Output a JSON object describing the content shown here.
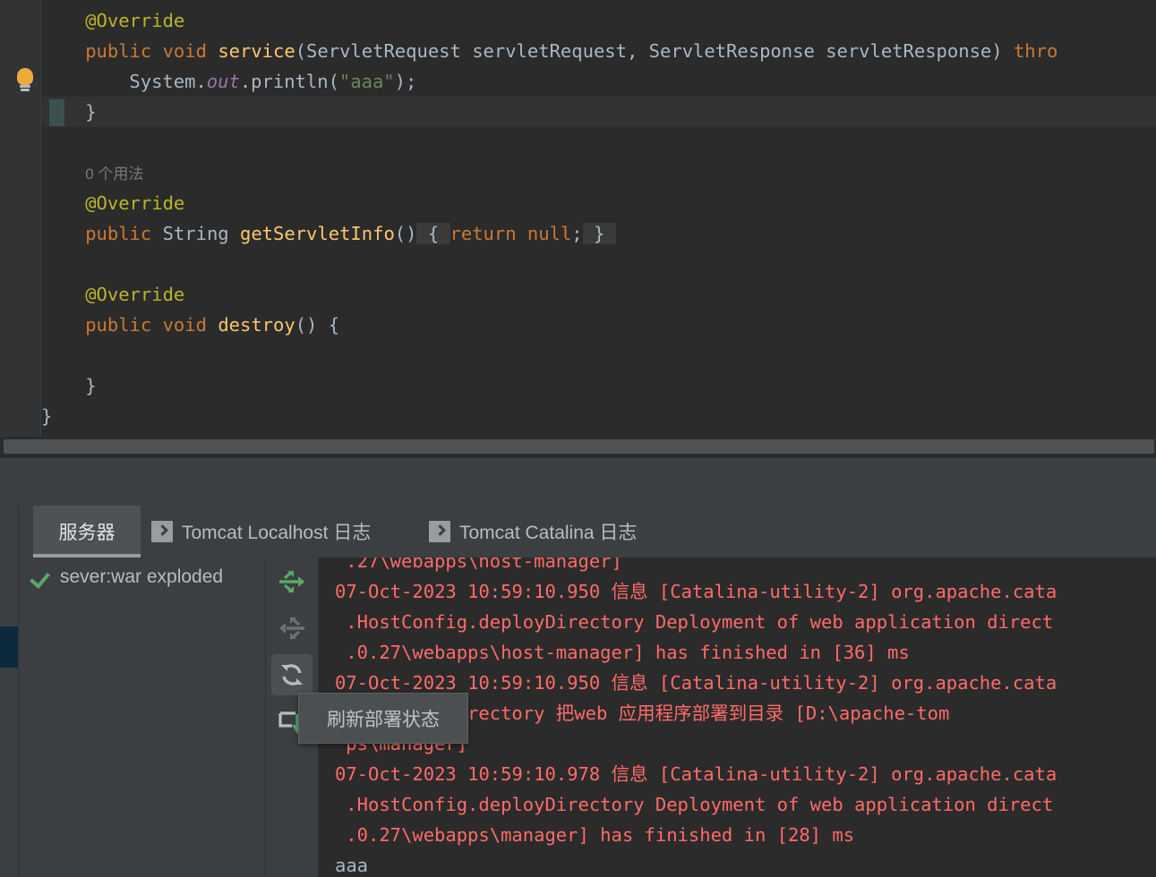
{
  "editor": {
    "name": "java-editor",
    "gutter_icon": "lightbulb-icon",
    "lines": [
      {
        "indent": 1,
        "segments": [
          {
            "t": "@Override",
            "c": "an"
          }
        ]
      },
      {
        "indent": 1,
        "segments": [
          {
            "t": "public ",
            "c": "kw"
          },
          {
            "t": "void ",
            "c": "kw"
          },
          {
            "t": "service",
            "c": "mth"
          },
          {
            "t": "(ServletRequest servletRequest, ServletResponse servletResponse) ",
            "c": "pln"
          },
          {
            "t": "thro",
            "c": "kw"
          }
        ]
      },
      {
        "indent": 2,
        "segments": [
          {
            "t": "System.",
            "c": "pln"
          },
          {
            "t": "out",
            "c": "fld"
          },
          {
            "t": ".println(",
            "c": "pln"
          },
          {
            "t": "\"aaa\"",
            "c": "str"
          },
          {
            "t": ");",
            "c": "pln"
          }
        ]
      },
      {
        "indent": 1,
        "segments": [
          {
            "t": "}",
            "c": "pln"
          }
        ]
      },
      {
        "indent": 0,
        "segments": []
      },
      {
        "indent": 1,
        "segments": [
          {
            "t": "0 个用法",
            "c": "inlay"
          }
        ]
      },
      {
        "indent": 1,
        "segments": [
          {
            "t": "@Override",
            "c": "an"
          }
        ]
      },
      {
        "indent": 1,
        "segments": [
          {
            "t": "public ",
            "c": "kw"
          },
          {
            "t": "String ",
            "c": "typ"
          },
          {
            "t": "getServletInfo",
            "c": "mth"
          },
          {
            "t": "()",
            "c": "pln"
          }
        ]
      },
      {
        "indent": 0,
        "segments": []
      },
      {
        "indent": 1,
        "segments": [
          {
            "t": "@Override",
            "c": "an"
          }
        ]
      },
      {
        "indent": 1,
        "segments": [
          {
            "t": "public ",
            "c": "kw"
          },
          {
            "t": "void ",
            "c": "kw"
          },
          {
            "t": "destroy",
            "c": "mth"
          },
          {
            "t": "() {",
            "c": "pln"
          }
        ]
      },
      {
        "indent": 0,
        "segments": []
      },
      {
        "indent": 1,
        "segments": [
          {
            "t": "}",
            "c": "pln"
          }
        ]
      },
      {
        "indent": 0,
        "segments": [
          {
            "t": "}",
            "c": "pln"
          }
        ]
      }
    ],
    "folded_body": {
      "open_brace": "{",
      "body": " return null; ",
      "close_brace": "}"
    },
    "inlay_hint": "0 个用法"
  },
  "tool_window": {
    "tabs": [
      {
        "id": "tab-services",
        "label": "服务器",
        "icon": null,
        "active": true
      },
      {
        "id": "tab-tomcat-localhost",
        "label": "Tomcat Localhost 日志",
        "icon": "console-icon",
        "active": false
      },
      {
        "id": "tab-tomcat-catalina",
        "label": "Tomcat Catalina 日志",
        "icon": "console-icon",
        "active": false
      }
    ],
    "tree": {
      "nodes": [
        {
          "id": "node-server-war-exploded",
          "label": "sever:war exploded",
          "status_icon": "green-check-icon"
        }
      ]
    },
    "toolbar_buttons": [
      {
        "id": "deploy-button",
        "icon": "deploy-arrow-icon",
        "state": "enabled",
        "color": "#59a869"
      },
      {
        "id": "undeploy-button",
        "icon": "undeploy-arrow-icon",
        "state": "disabled",
        "color": "#6e7173"
      },
      {
        "id": "refresh-button",
        "icon": "refresh-icon",
        "state": "hovered",
        "color": "#b9bdc0"
      },
      {
        "id": "download-button",
        "icon": "download-arrow-icon",
        "state": "enabled",
        "color": "#59a869"
      }
    ],
    "tooltip": {
      "id": "refresh-tooltip",
      "text": "刷新部署状态"
    },
    "console": {
      "lines": [
        {
          "t": ".27\\webapps\\host-manager]",
          "indent": 1,
          "stream": "err",
          "clipped_top": true
        },
        {
          "t": "07-Oct-2023 10:59:10.950 信息 [Catalina-utility-2] org.apache.cata",
          "indent": 0,
          "stream": "err"
        },
        {
          "t": ".HostConfig.deployDirectory Deployment of web application direct",
          "indent": 1,
          "stream": "err"
        },
        {
          "t": ".0.27\\webapps\\host-manager] has finished in [36] ms",
          "indent": 1,
          "stream": "err"
        },
        {
          "t": "07-Oct-2023 10:59:10.950 信息 [Catalina-utility-2] org.apache.cata",
          "indent": 0,
          "stream": "err"
        },
        {
          "t": "ig.deployDirectory 把web 应用程序部署到目录 [D:\\apache-tom",
          "indent": 1,
          "stream": "err"
        },
        {
          "t": "ps\\manager]",
          "indent": 1,
          "stream": "err"
        },
        {
          "t": "07-Oct-2023 10:59:10.978 信息 [Catalina-utility-2] org.apache.cata",
          "indent": 0,
          "stream": "err"
        },
        {
          "t": ".HostConfig.deployDirectory Deployment of web application direct",
          "indent": 1,
          "stream": "err"
        },
        {
          "t": ".0.27\\webapps\\manager] has finished in [28] ms",
          "indent": 1,
          "stream": "err"
        },
        {
          "t": "aaa",
          "indent": 0,
          "stream": "out"
        }
      ]
    }
  },
  "colors": {
    "editor_bg": "#2b2b2b",
    "panel_bg": "#3c3f41",
    "console_bg": "#2b2b2b",
    "stderr": "#ff6b68",
    "stdout": "#a9b7c6",
    "annotation": "#bbb529",
    "keyword": "#cc7832",
    "method": "#ffc66d",
    "string": "#6a8759",
    "static_field": "#9876aa",
    "success_green": "#59a869",
    "rail_accent": "#0d293e"
  }
}
